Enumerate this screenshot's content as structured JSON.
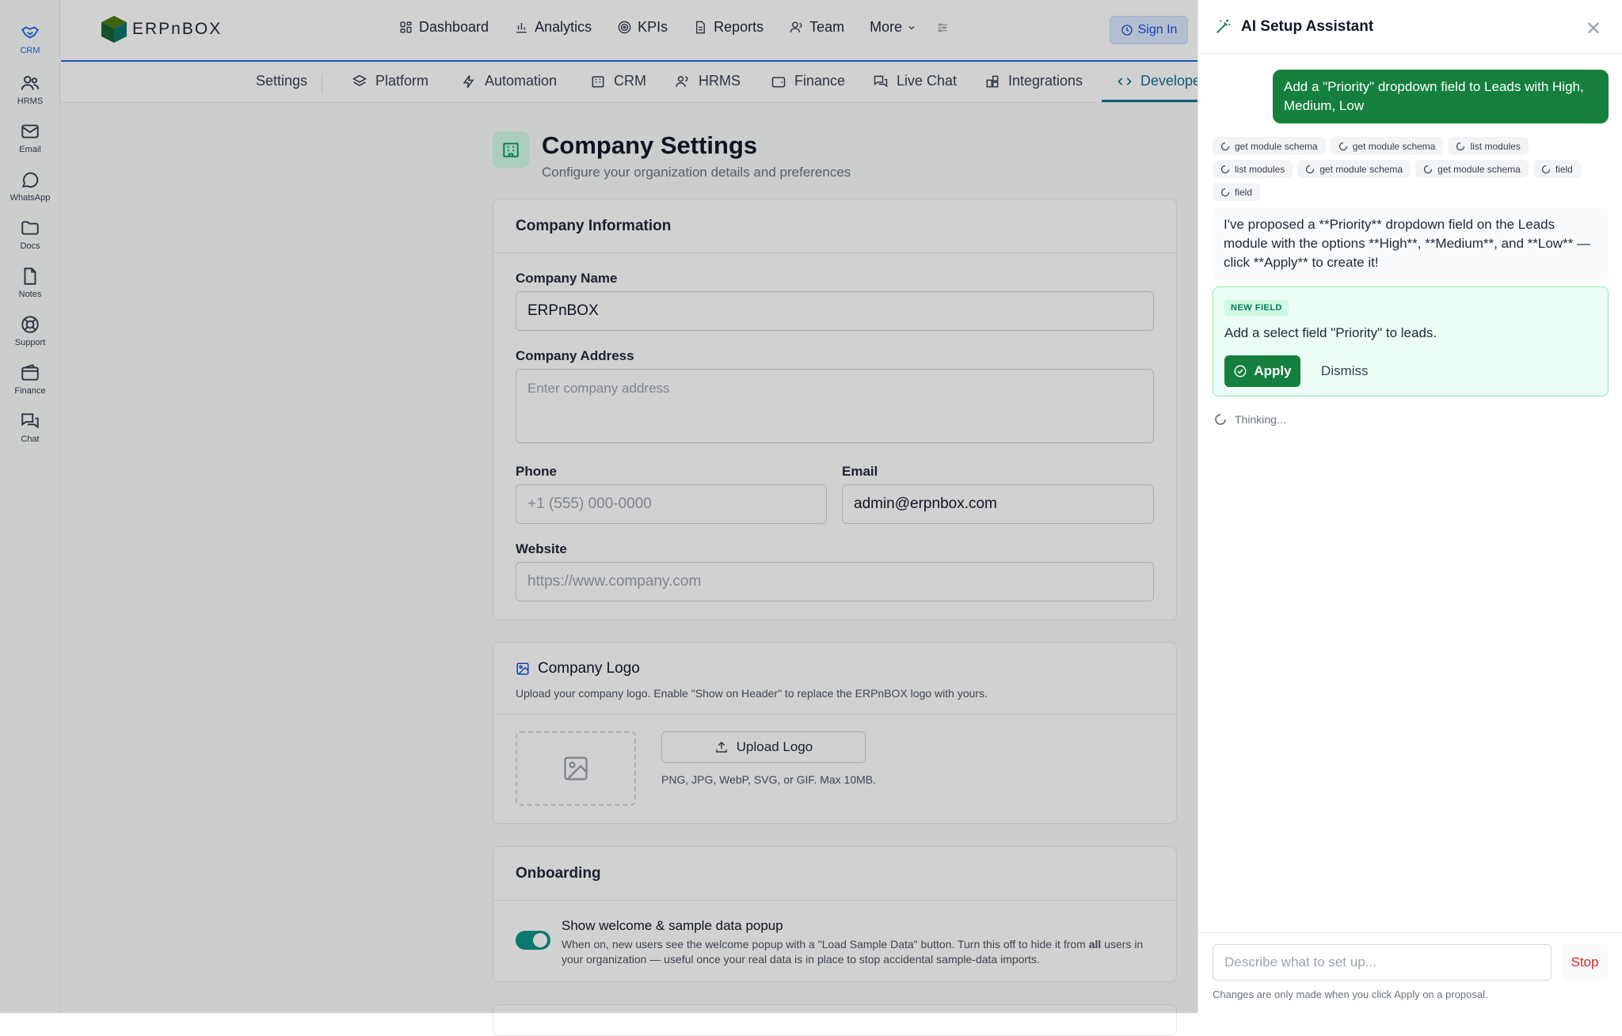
{
  "rail": {
    "items": [
      {
        "label": "CRM",
        "icon": "handshake-icon"
      },
      {
        "label": "HRMS",
        "icon": "users-icon"
      },
      {
        "label": "Email",
        "icon": "mail-icon"
      },
      {
        "label": "WhatsApp",
        "icon": "chat-bubble-icon"
      },
      {
        "label": "Docs",
        "icon": "folder-icon"
      },
      {
        "label": "Notes",
        "icon": "file-icon"
      },
      {
        "label": "Support",
        "icon": "lifebuoy-icon"
      },
      {
        "label": "Finance",
        "icon": "wallet-icon"
      },
      {
        "label": "Chat",
        "icon": "messages-icon"
      }
    ]
  },
  "header": {
    "brand": "ERPnBOX",
    "nav": [
      "Dashboard",
      "Analytics",
      "KPIs",
      "Reports",
      "Team",
      "More"
    ],
    "sign_in": "Sign In"
  },
  "subnav": {
    "items": [
      "Settings",
      "Platform",
      "Automation",
      "CRM",
      "HRMS",
      "Finance",
      "Live Chat",
      "Integrations",
      "Develope"
    ]
  },
  "page": {
    "title": "Company Settings",
    "subtitle": "Configure your organization details and preferences"
  },
  "company_info": {
    "heading": "Company Information",
    "name_label": "Company Name",
    "name_value": "ERPnBOX",
    "address_label": "Company Address",
    "address_placeholder": "Enter company address",
    "phone_label": "Phone",
    "phone_placeholder": "+1 (555) 000-0000",
    "email_label": "Email",
    "email_value": "admin@erpnbox.com",
    "website_label": "Website",
    "website_placeholder": "https://www.company.com"
  },
  "logo": {
    "heading": "Company Logo",
    "desc": "Upload your company logo. Enable \"Show on Header\" to replace the ERPnBOX logo with yours.",
    "upload_label": "Upload Logo",
    "formats": "PNG, JPG, WebP, SVG, or GIF. Max 10MB."
  },
  "onboarding": {
    "heading": "Onboarding",
    "toggle_label": "Show welcome & sample data popup",
    "toggle_on": true,
    "desc_1": "When on, new users see the welcome popup with a \"Load Sample Data\" button. Turn this off to hide it from",
    "desc_bold": "all",
    "desc_2": "users",
    "desc_3": "in your organization — useful once your real data is in place to stop accidental sample-data imports."
  },
  "assistant": {
    "title": "AI Setup Assistant",
    "user_message": "Add a \"Priority\" dropdown field to Leads with High, Medium, Low",
    "tool_chips": [
      "get module schema",
      "get module schema",
      "list modules",
      "list modules",
      "get module schema",
      "get module schema",
      "field",
      "field"
    ],
    "bot_message": "I've proposed a **Priority** dropdown field on the Leads module with the options **High**, **Medium**, and **Low** — click **Apply** to create it!",
    "proposal": {
      "tag": "NEW FIELD",
      "text": "Add a select field \"Priority\" to leads.",
      "apply": "Apply",
      "dismiss": "Dismiss"
    },
    "status": "Thinking...",
    "input_placeholder": "Describe what to set up...",
    "stop": "Stop",
    "footnote": "Changes are only made when you click Apply on a proposal."
  },
  "colors": {
    "brand_green": "#15803d",
    "accent_blue": "#2563eb",
    "teal_active": "#0e7490"
  }
}
